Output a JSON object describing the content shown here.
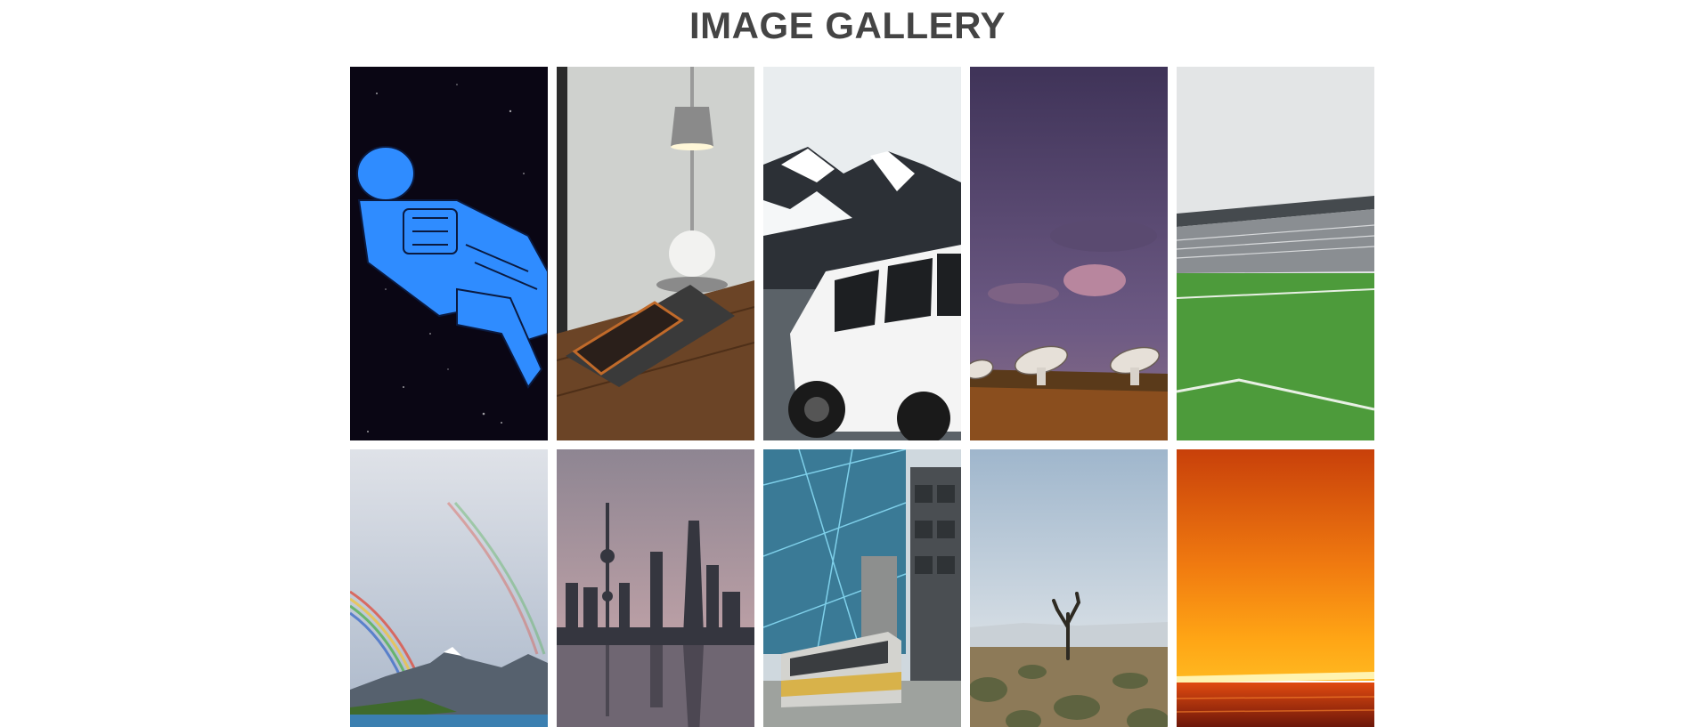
{
  "page": {
    "title": "IMAGE GALLERY"
  },
  "gallery": {
    "items": [
      {
        "subject": "astronaut-illustration",
        "palette": {
          "bg": "#0a0614",
          "accent": "#2f8cff"
        }
      },
      {
        "subject": "desk-lamp-phone",
        "palette": {
          "bg": "#c9cbc8",
          "accent": "#5a3a22"
        }
      },
      {
        "subject": "mountain-jeep",
        "palette": {
          "bg": "#e8ecee",
          "accent": "#ffffff"
        }
      },
      {
        "subject": "radio-telescopes",
        "palette": {
          "bg": "#4a3f66",
          "accent": "#b06a2a"
        }
      },
      {
        "subject": "football-stadium",
        "palette": {
          "bg": "#e3e5e6",
          "accent": "#4f9a3c"
        }
      },
      {
        "subject": "rainbow-lake",
        "palette": {
          "bg": "#c5cbd6",
          "accent": "#3d7ea6"
        }
      },
      {
        "subject": "city-skyline-reflection",
        "palette": {
          "bg": "#b29ea4",
          "accent": "#3a3b44"
        }
      },
      {
        "subject": "glass-tower-tram",
        "palette": {
          "bg": "#3a6f8a",
          "accent": "#d8b24a"
        }
      },
      {
        "subject": "joshua-tree-desert",
        "palette": {
          "bg": "#a9bfd3",
          "accent": "#7b6a4c"
        }
      },
      {
        "subject": "orange-gradient-horizon",
        "palette": {
          "bg": "#f07a10",
          "accent": "#ffe38a"
        }
      }
    ]
  }
}
